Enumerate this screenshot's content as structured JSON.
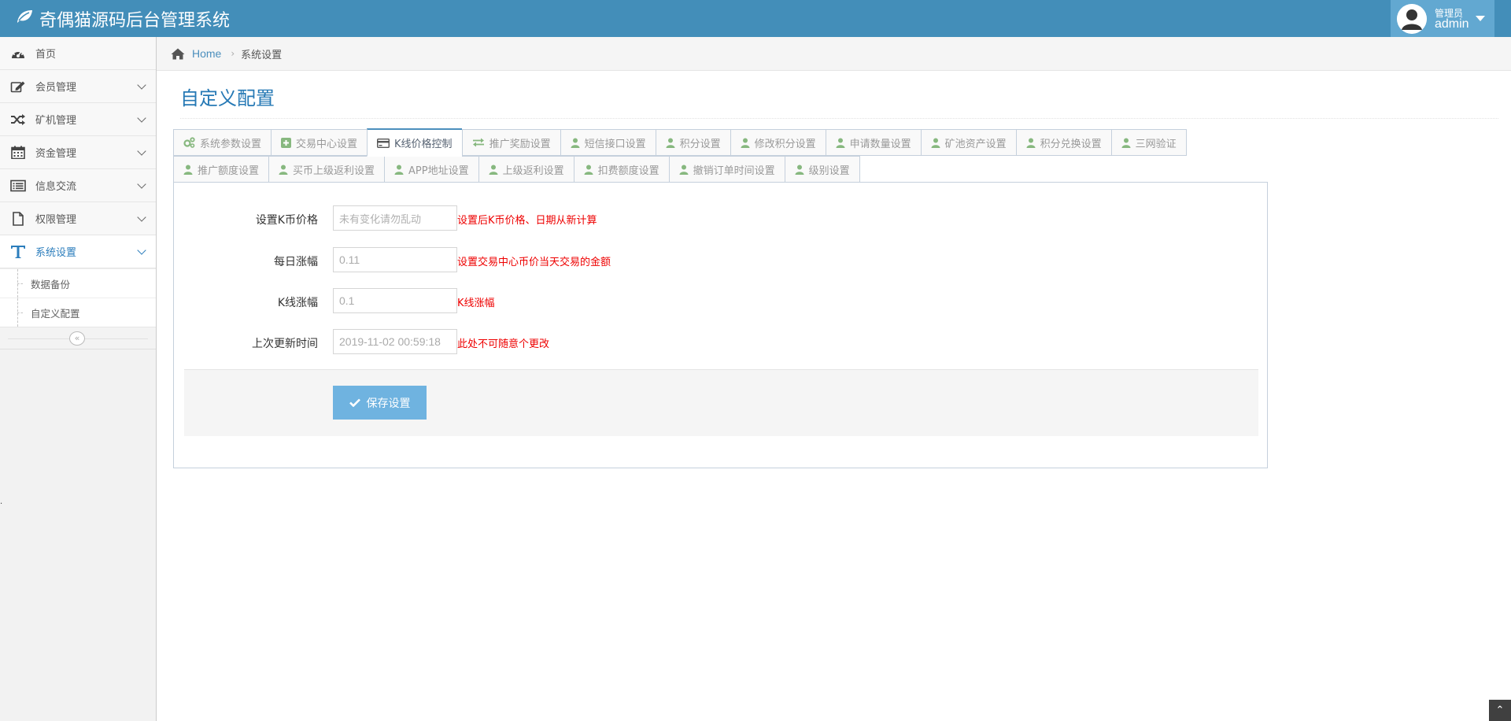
{
  "app": {
    "title": "奇偶猫源码后台管理系统"
  },
  "user": {
    "role": "管理员",
    "name": "admin"
  },
  "sidebar": {
    "items": [
      {
        "label": "首页",
        "icon": "dashboard-icon"
      },
      {
        "label": "会员管理",
        "icon": "edit-icon"
      },
      {
        "label": "矿机管理",
        "icon": "shuffle-icon"
      },
      {
        "label": "资金管理",
        "icon": "calendar-icon"
      },
      {
        "label": "信息交流",
        "icon": "list-icon"
      },
      {
        "label": "权限管理",
        "icon": "file-icon"
      },
      {
        "label": "系统设置",
        "icon": "text-icon"
      }
    ],
    "subitems": [
      {
        "label": "数据备份"
      },
      {
        "label": "自定义配置"
      }
    ]
  },
  "breadcrumb": {
    "home": "Home",
    "current": "系统设置"
  },
  "page": {
    "title": "自定义配置"
  },
  "tabs": {
    "row1": [
      {
        "label": "系统参数设置",
        "icon": "cogs-icon"
      },
      {
        "label": "交易中心设置",
        "icon": "plus-square-icon"
      },
      {
        "label": "K线价格控制",
        "icon": "credit-card-icon"
      },
      {
        "label": "推广奖励设置",
        "icon": "exchange-icon"
      },
      {
        "label": "短信接口设置",
        "icon": "user-icon"
      },
      {
        "label": "积分设置",
        "icon": "user-icon"
      },
      {
        "label": "修改积分设置",
        "icon": "user-icon"
      },
      {
        "label": "申请数量设置",
        "icon": "user-icon"
      },
      {
        "label": "矿池资产设置",
        "icon": "user-icon"
      },
      {
        "label": "积分兑换设置",
        "icon": "user-icon"
      },
      {
        "label": "三网验证",
        "icon": "user-icon"
      }
    ],
    "row2": [
      {
        "label": "推广额度设置",
        "icon": "user-icon"
      },
      {
        "label": "买币上级返利设置",
        "icon": "user-icon"
      },
      {
        "label": "APP地址设置",
        "icon": "user-icon"
      },
      {
        "label": "上级返利设置",
        "icon": "user-icon"
      },
      {
        "label": "扣费额度设置",
        "icon": "user-icon"
      },
      {
        "label": "撤销订单时间设置",
        "icon": "user-icon"
      },
      {
        "label": "级别设置",
        "icon": "user-icon"
      }
    ],
    "active": "K线价格控制"
  },
  "form": {
    "fields": [
      {
        "label": "设置K币价格",
        "value": "",
        "placeholder": "未有变化请勿乱动",
        "hint": "设置后K币价格、日期从新计算"
      },
      {
        "label": "每日涨幅",
        "value": "0.11",
        "placeholder": "",
        "hint": "设置交易中心币价当天交易的金额"
      },
      {
        "label": "K线涨幅",
        "value": "0.1",
        "placeholder": "",
        "hint": "K线涨幅"
      },
      {
        "label": "上次更新时间",
        "value": "2019-11-02 00:59:18",
        "placeholder": "",
        "hint": "此处不可随意个更改"
      }
    ],
    "save_label": "保存设置"
  },
  "colors": {
    "navbar": "#438eb9",
    "accent": "#2679b5",
    "button": "#6fb3e0",
    "hint": "#ee0000",
    "tab_icon": "#87b87f"
  }
}
